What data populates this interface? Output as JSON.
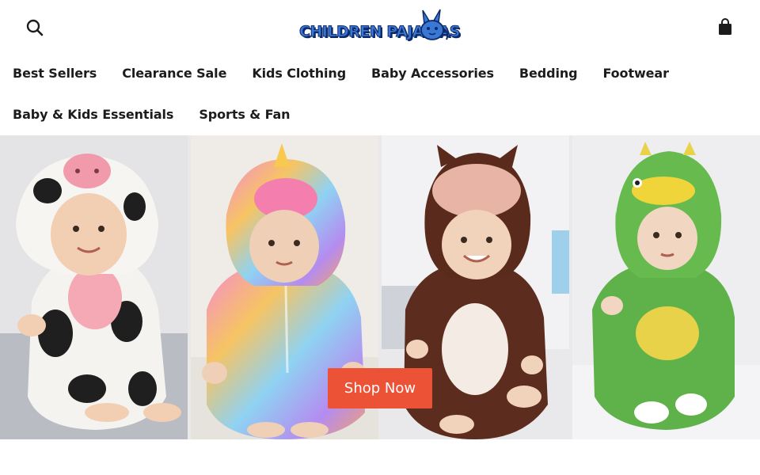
{
  "header": {
    "logo": {
      "text": "CHILDREN PAJAMAS",
      "icon": "bunny-mascot-icon",
      "colors": {
        "fill": "#3a78d6",
        "outline": "#0e2a6b"
      }
    },
    "search_icon": "search-icon",
    "cart_icon": "shopping-bag-icon"
  },
  "nav": {
    "row1": [
      {
        "label": "Best Sellers"
      },
      {
        "label": "Clearance Sale"
      },
      {
        "label": "Kids Clothing"
      },
      {
        "label": "Baby Accessories"
      },
      {
        "label": "Bedding"
      },
      {
        "label": "Footwear"
      }
    ],
    "row2": [
      {
        "label": "Baby & Kids Essentials"
      },
      {
        "label": "Sports & Fan"
      }
    ]
  },
  "hero": {
    "panels": [
      {
        "subject": "cow-onesie"
      },
      {
        "subject": "rainbow-unicorn-onesie"
      },
      {
        "subject": "brown-bear-onesie"
      },
      {
        "subject": "green-dinosaur-onesie"
      }
    ],
    "cta": {
      "label": "Shop Now",
      "color": "#ec5235"
    }
  }
}
